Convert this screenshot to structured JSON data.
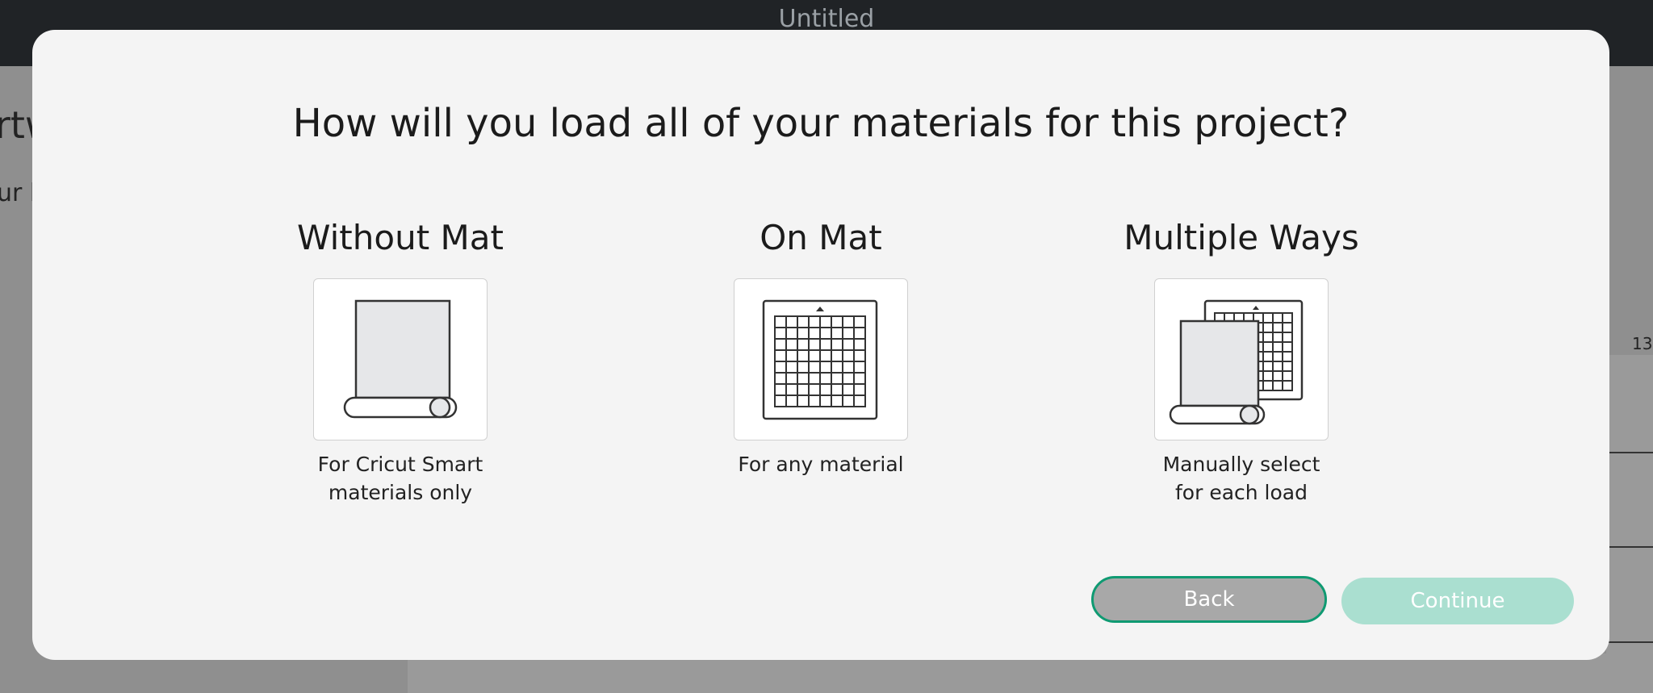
{
  "app": {
    "title": "Untitled"
  },
  "background": {
    "left_text_1": "rtw",
    "left_text_2": "ur l",
    "ruler_number": "13"
  },
  "dialog": {
    "title": "How will you load all of your materials for this project?",
    "options": [
      {
        "title": "Without Mat",
        "desc_line1": "For Cricut Smart",
        "desc_line2": "materials only",
        "icon": "roll-material-icon"
      },
      {
        "title": "On Mat",
        "desc_line1": "For any material",
        "desc_line2": "",
        "icon": "cutting-mat-icon"
      },
      {
        "title": "Multiple Ways",
        "desc_line1": "Manually select",
        "desc_line2": "for each load",
        "icon": "multiple-load-icon"
      }
    ],
    "buttons": {
      "back": "Back",
      "continue": "Continue"
    }
  },
  "colors": {
    "accent": "#0f9a72",
    "continue_disabled": "#aadfd0",
    "back_button": "#a8a8a8"
  }
}
